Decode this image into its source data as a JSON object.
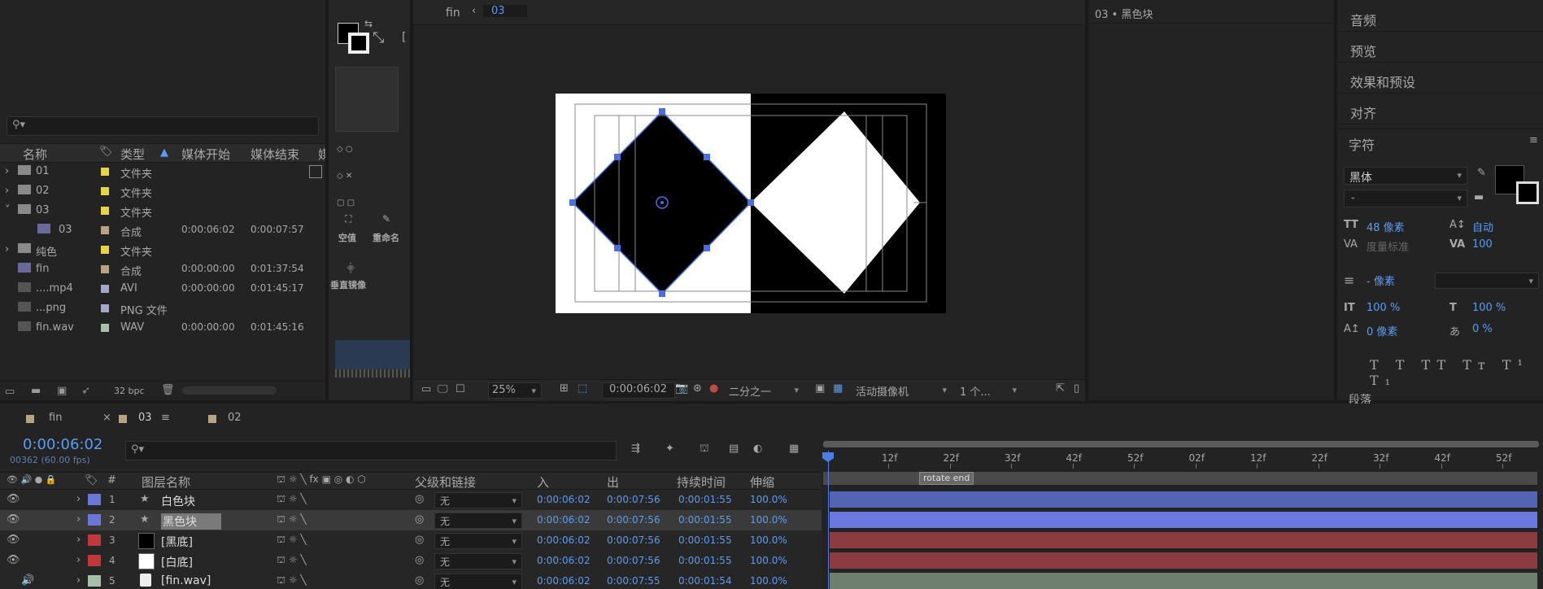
{
  "project": {
    "search_placeholder": "",
    "columns": [
      "名称",
      "类型",
      "媒体开始",
      "媒体结束",
      "媒"
    ],
    "items": [
      {
        "name": "01",
        "type": "文件夹",
        "start": "",
        "end": "",
        "color": "#e7d34a",
        "kind": "folder",
        "expand": "›"
      },
      {
        "name": "02",
        "type": "文件夹",
        "start": "",
        "end": "",
        "color": "#e7d34a",
        "kind": "folder",
        "expand": "›"
      },
      {
        "name": "03",
        "type": "文件夹",
        "start": "",
        "end": "",
        "color": "#e7d34a",
        "kind": "folder",
        "expand": "˅"
      },
      {
        "name": "03",
        "type": "合成",
        "start": "0:00:06:02",
        "end": "0:00:07:57",
        "color": "#b8a483",
        "kind": "comp",
        "expand": ""
      },
      {
        "name": "纯色",
        "type": "文件夹",
        "start": "",
        "end": "",
        "color": "#e7d34a",
        "kind": "folder",
        "expand": "›"
      },
      {
        "name": "fin",
        "type": "合成",
        "start": "0:00:00:00",
        "end": "0:01:37:54",
        "color": "#b8a483",
        "kind": "comp",
        "expand": ""
      },
      {
        "name": "....mp4",
        "type": "AVI",
        "start": "0:00:00:00",
        "end": "0:01:45:17",
        "color": "#a4a7c8",
        "kind": "video",
        "expand": ""
      },
      {
        "name": "...png",
        "type": "PNG 文件",
        "start": "",
        "end": "",
        "color": "#a4a7c8",
        "kind": "image",
        "expand": ""
      },
      {
        "name": "fin.wav",
        "type": "WAV",
        "start": "0:00:00:00",
        "end": "0:01:45:16",
        "color": "#a7c0a7",
        "kind": "audio",
        "expand": ""
      }
    ],
    "bpc": "32 bpc"
  },
  "tools": {
    "null_label": "空值",
    "rename_label": "重命名",
    "flip_label": "垂直镜像"
  },
  "viewer": {
    "comp_name": "fin",
    "comp_tab": "03",
    "zoom": "25%",
    "timecode": "0:00:06:02",
    "resolution": "二分之一",
    "camera": "活动摄像机",
    "views": "1 个..."
  },
  "layer_panel": {
    "title": "03 • 黑色块"
  },
  "right_panel": {
    "items": [
      "音频",
      "预览",
      "效果和预设",
      "对齐"
    ],
    "char_title": "字符",
    "font": "黑体",
    "style": "-",
    "size": "48 像素",
    "leading": "自动",
    "kerning": "度量标准",
    "tracking": "100",
    "stroke": "- 像素",
    "vscale": "100 %",
    "hscale": "100 %",
    "baseline": "0 像素",
    "tsume": "0 %",
    "paragraph": "段落"
  },
  "timeline": {
    "tabs": [
      "fin",
      "03",
      "02"
    ],
    "tab_colors": [
      "#b8a483",
      "#b8a483",
      "#b8a483"
    ],
    "current_time": "0:00:06:02",
    "frame_info": "00362 (60.00 fps)",
    "col_headers": {
      "num": "#",
      "name": "图层名称",
      "parent": "父级和链接",
      "in": "入",
      "out": "出",
      "duration": "持续时间",
      "stretch": "伸缩"
    },
    "ruler_ticks": [
      "12f",
      "22f",
      "32f",
      "42f",
      "52f",
      "02f",
      "12f",
      "22f",
      "32f",
      "42f",
      "52f"
    ],
    "marker": "rotate end",
    "layers": [
      {
        "num": "1",
        "name": "白色块",
        "label": "#6b77d6",
        "parent": "无",
        "in": "0:00:06:02",
        "out": "0:00:07:56",
        "duration": "0:00:01:55",
        "stretch": "100.0%",
        "bar": "#5464b4",
        "type": "shape",
        "selected": false
      },
      {
        "num": "2",
        "name": "黑色块",
        "label": "#6b77d6",
        "parent": "无",
        "in": "0:00:06:02",
        "out": "0:00:07:56",
        "duration": "0:00:01:55",
        "stretch": "100.0%",
        "bar": "#6a78e0",
        "type": "shape",
        "selected": true
      },
      {
        "num": "3",
        "name": "[黑底]",
        "label": "#c0383c",
        "parent": "无",
        "in": "0:00:06:02",
        "out": "0:00:07:56",
        "duration": "0:00:01:55",
        "stretch": "100.0%",
        "bar": "#8c3b40",
        "type": "solid-black",
        "selected": false
      },
      {
        "num": "4",
        "name": "[白底]",
        "label": "#c0383c",
        "parent": "无",
        "in": "0:00:06:02",
        "out": "0:00:07:56",
        "duration": "0:00:01:55",
        "stretch": "100.0%",
        "bar": "#8c3b40",
        "type": "solid-white",
        "selected": false
      },
      {
        "num": "5",
        "name": "[fin.wav]",
        "label": "#a7c0a7",
        "parent": "无",
        "in": "0:00:06:02",
        "out": "0:00:07:55",
        "duration": "0:00:01:54",
        "stretch": "100.0%",
        "bar": "#6f7f6f",
        "type": "audio",
        "selected": false
      }
    ]
  },
  "colors": {
    "accent": "#5b9cf0",
    "selection_handle": "#4a6ee0"
  }
}
